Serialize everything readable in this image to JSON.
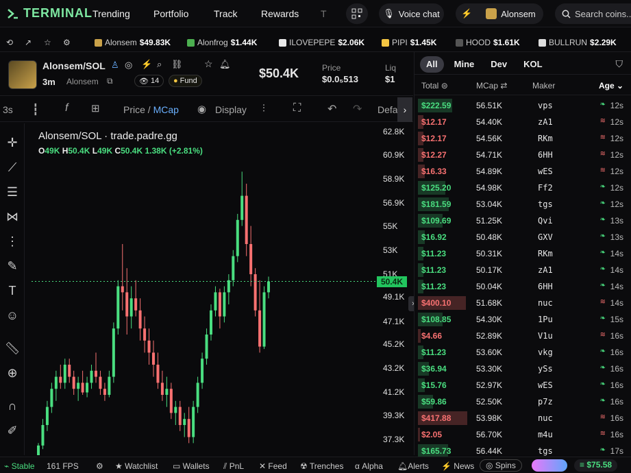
{
  "app": {
    "name": "TERMINAL"
  },
  "nav": {
    "links": [
      "Trending",
      "Portfolio",
      "Track",
      "Rewards",
      "T"
    ],
    "voice_chat": "Voice chat",
    "user": "Alonsem",
    "search_placeholder": "Search coins..."
  },
  "ticker": [
    {
      "name": "Alonsem",
      "price": "$49.83K",
      "color": "#caa24a"
    },
    {
      "name": "Alonfrog",
      "price": "$1.44K",
      "color": "#4caf50"
    },
    {
      "name": "ILOVEPEPE",
      "price": "$2.06K",
      "color": "#e8e8e8"
    },
    {
      "name": "PIPI",
      "price": "$1.45K",
      "color": "#f4c542"
    },
    {
      "name": "HOOD",
      "price": "$1.61K",
      "color": "#555"
    },
    {
      "name": "BULLRUN",
      "price": "$2.29K",
      "color": "#ddd"
    }
  ],
  "token": {
    "pair": "Alonsem/SOL",
    "age": "3m",
    "creator": "Alonsem",
    "holders": "14",
    "fund": "Fund",
    "mcap": "$50.4K",
    "price_label": "Price",
    "price": "$0.0₅513",
    "liq_label": "Liq",
    "liq": "$1"
  },
  "toolbar": {
    "interval": "3s",
    "price_mcap": "Price / ",
    "mcap": "MCap",
    "display": "Display",
    "default": "Defau"
  },
  "chart_data": {
    "type": "candlestick",
    "title": "Alonsem/SOL · trade.padre.gg",
    "ohlc": {
      "o": "49K",
      "h": "50.4K",
      "l": "49K",
      "c": "50.4K",
      "change": "1.38K (+2.81%)"
    },
    "ylim": [
      36000,
      63500
    ],
    "y_ticks": [
      "62.8K",
      "60.9K",
      "58.9K",
      "56.9K",
      "55K",
      "53K",
      "51K",
      "49.1K",
      "47.1K",
      "45.2K",
      "43.2K",
      "41.2K",
      "39.3K",
      "37.3K"
    ],
    "y_tick_values": [
      62800,
      60900,
      58900,
      56900,
      55000,
      53000,
      51000,
      49100,
      47100,
      45200,
      43200,
      41200,
      39300,
      37300
    ],
    "last_price_label": "50.4K",
    "last_price": 50400,
    "candles": [
      [
        36000,
        37000,
        35500,
        36800
      ],
      [
        36800,
        39000,
        36500,
        38500
      ],
      [
        38500,
        40500,
        38000,
        40000
      ],
      [
        40000,
        42000,
        39500,
        41500
      ],
      [
        41500,
        43000,
        40500,
        42500
      ],
      [
        42500,
        43500,
        41500,
        42000
      ],
      [
        42000,
        44000,
        41500,
        43500
      ],
      [
        43500,
        44000,
        42000,
        42500
      ],
      [
        42500,
        43000,
        41000,
        41500
      ],
      [
        41500,
        42500,
        40500,
        42000
      ],
      [
        42000,
        43000,
        41000,
        41200
      ],
      [
        41200,
        42500,
        40800,
        42000
      ],
      [
        42000,
        43500,
        41500,
        43000
      ],
      [
        43000,
        44500,
        42000,
        42500
      ],
      [
        42500,
        43000,
        41000,
        41500
      ],
      [
        41500,
        42000,
        40500,
        41000
      ],
      [
        41000,
        43000,
        40800,
        42500
      ],
      [
        42500,
        47000,
        42000,
        46500
      ],
      [
        46500,
        50500,
        46000,
        50000
      ],
      [
        50000,
        53500,
        48000,
        49500
      ],
      [
        49500,
        51500,
        46000,
        47500
      ],
      [
        47500,
        50000,
        46500,
        49000
      ],
      [
        49000,
        50500,
        47500,
        48000
      ],
      [
        48000,
        49000,
        45500,
        46500
      ],
      [
        46500,
        47500,
        44500,
        45500
      ],
      [
        45500,
        46500,
        43500,
        44500
      ],
      [
        44500,
        45500,
        42500,
        43500
      ],
      [
        43500,
        44500,
        41500,
        42000
      ],
      [
        42000,
        43000,
        40500,
        41000
      ],
      [
        41000,
        42500,
        40000,
        41500
      ],
      [
        41500,
        42000,
        39000,
        39500
      ],
      [
        39500,
        40500,
        38500,
        40000
      ],
      [
        40000,
        40500,
        38000,
        38500
      ],
      [
        38500,
        39500,
        37500,
        39000
      ],
      [
        39000,
        40000,
        37000,
        37500
      ],
      [
        37500,
        40500,
        37000,
        40000
      ],
      [
        40000,
        42500,
        39500,
        42000
      ],
      [
        42000,
        44500,
        41500,
        44000
      ],
      [
        44000,
        46500,
        43500,
        46000
      ],
      [
        46000,
        48500,
        45500,
        48000
      ],
      [
        48000,
        50000,
        47500,
        49500
      ],
      [
        49500,
        49800,
        46500,
        47500
      ],
      [
        47500,
        50000,
        47000,
        49500
      ],
      [
        49500,
        51000,
        48500,
        50500
      ],
      [
        50500,
        53000,
        50000,
        52500
      ],
      [
        52500,
        56000,
        52000,
        55500
      ],
      [
        55500,
        59500,
        55000,
        57500
      ],
      [
        57500,
        58500,
        52500,
        53500
      ],
      [
        53500,
        55000,
        50000,
        51000
      ],
      [
        51000,
        51500,
        47500,
        48000
      ],
      [
        48000,
        50500,
        44500,
        45000
      ],
      [
        45000,
        50000,
        44800,
        49500
      ],
      [
        49500,
        50800,
        49000,
        50400
      ]
    ]
  },
  "trades": {
    "tabs": [
      "All",
      "Mine",
      "Dev",
      "KOL"
    ],
    "headers": {
      "total": "Total",
      "mcap": "MCap",
      "maker": "Maker",
      "age": "Age"
    },
    "rows": [
      {
        "total": "$222.59",
        "mcap": "56.51K",
        "maker": "vps",
        "age": "12s",
        "side": "buy",
        "w": 50
      },
      {
        "total": "$12.17",
        "mcap": "54.40K",
        "maker": "zA1",
        "age": "12s",
        "side": "sell",
        "w": 8
      },
      {
        "total": "$12.17",
        "mcap": "54.56K",
        "maker": "RKm",
        "age": "12s",
        "side": "sell",
        "w": 8
      },
      {
        "total": "$12.27",
        "mcap": "54.71K",
        "maker": "6HH",
        "age": "12s",
        "side": "sell",
        "w": 8
      },
      {
        "total": "$16.33",
        "mcap": "54.89K",
        "maker": "wES",
        "age": "12s",
        "side": "sell",
        "w": 10
      },
      {
        "total": "$125.20",
        "mcap": "54.98K",
        "maker": "Ff2",
        "age": "12s",
        "side": "buy",
        "w": 40
      },
      {
        "total": "$181.59",
        "mcap": "53.04K",
        "maker": "tgs",
        "age": "12s",
        "side": "buy",
        "w": 45
      },
      {
        "total": "$109.69",
        "mcap": "51.25K",
        "maker": "Qvi",
        "age": "13s",
        "side": "buy",
        "w": 36
      },
      {
        "total": "$16.92",
        "mcap": "50.48K",
        "maker": "GXV",
        "age": "13s",
        "side": "buy",
        "w": 10
      },
      {
        "total": "$11.23",
        "mcap": "50.31K",
        "maker": "RKm",
        "age": "14s",
        "side": "buy",
        "w": 8
      },
      {
        "total": "$11.23",
        "mcap": "50.17K",
        "maker": "zA1",
        "age": "14s",
        "side": "buy",
        "w": 8
      },
      {
        "total": "$11.23",
        "mcap": "50.04K",
        "maker": "6HH",
        "age": "14s",
        "side": "buy",
        "w": 8
      },
      {
        "total": "$400.10",
        "mcap": "51.68K",
        "maker": "nuc",
        "age": "14s",
        "side": "sell",
        "w": 70
      },
      {
        "total": "$108.85",
        "mcap": "54.30K",
        "maker": "1Pu",
        "age": "15s",
        "side": "buy",
        "w": 36
      },
      {
        "total": "$4.66",
        "mcap": "52.89K",
        "maker": "V1u",
        "age": "16s",
        "side": "sell",
        "w": 4
      },
      {
        "total": "$11.23",
        "mcap": "53.60K",
        "maker": "vkg",
        "age": "16s",
        "side": "buy",
        "w": 8
      },
      {
        "total": "$36.94",
        "mcap": "53.30K",
        "maker": "ySs",
        "age": "16s",
        "side": "buy",
        "w": 16
      },
      {
        "total": "$15.76",
        "mcap": "52.97K",
        "maker": "wES",
        "age": "16s",
        "side": "buy",
        "w": 10
      },
      {
        "total": "$59.86",
        "mcap": "52.50K",
        "maker": "p7z",
        "age": "16s",
        "side": "buy",
        "w": 22
      },
      {
        "total": "$417.88",
        "mcap": "53.98K",
        "maker": "nuc",
        "age": "16s",
        "side": "sell",
        "w": 72
      },
      {
        "total": "$2.05",
        "mcap": "56.70K",
        "maker": "m4u",
        "age": "16s",
        "side": "sell",
        "w": 3
      },
      {
        "total": "$165.73",
        "mcap": "56.44K",
        "maker": "tgs",
        "age": "17s",
        "side": "buy",
        "w": 44
      }
    ]
  },
  "status": {
    "stable": "Stable",
    "fps": "161 FPS",
    "watchlist": "Watchlist",
    "wallets": "Wallets",
    "pnl": "PnL",
    "feed": "Feed",
    "trenches": "Trenches",
    "alpha": "Alpha",
    "alerts": "Alerts",
    "news": "News",
    "spins": "Spins",
    "balance": "$75.58"
  },
  "colors": {
    "accent": "#7ee8a2",
    "buy": "#4ade80",
    "sell": "#f87171",
    "candle_up": "#4ade80",
    "candle_down": "#f87171"
  }
}
